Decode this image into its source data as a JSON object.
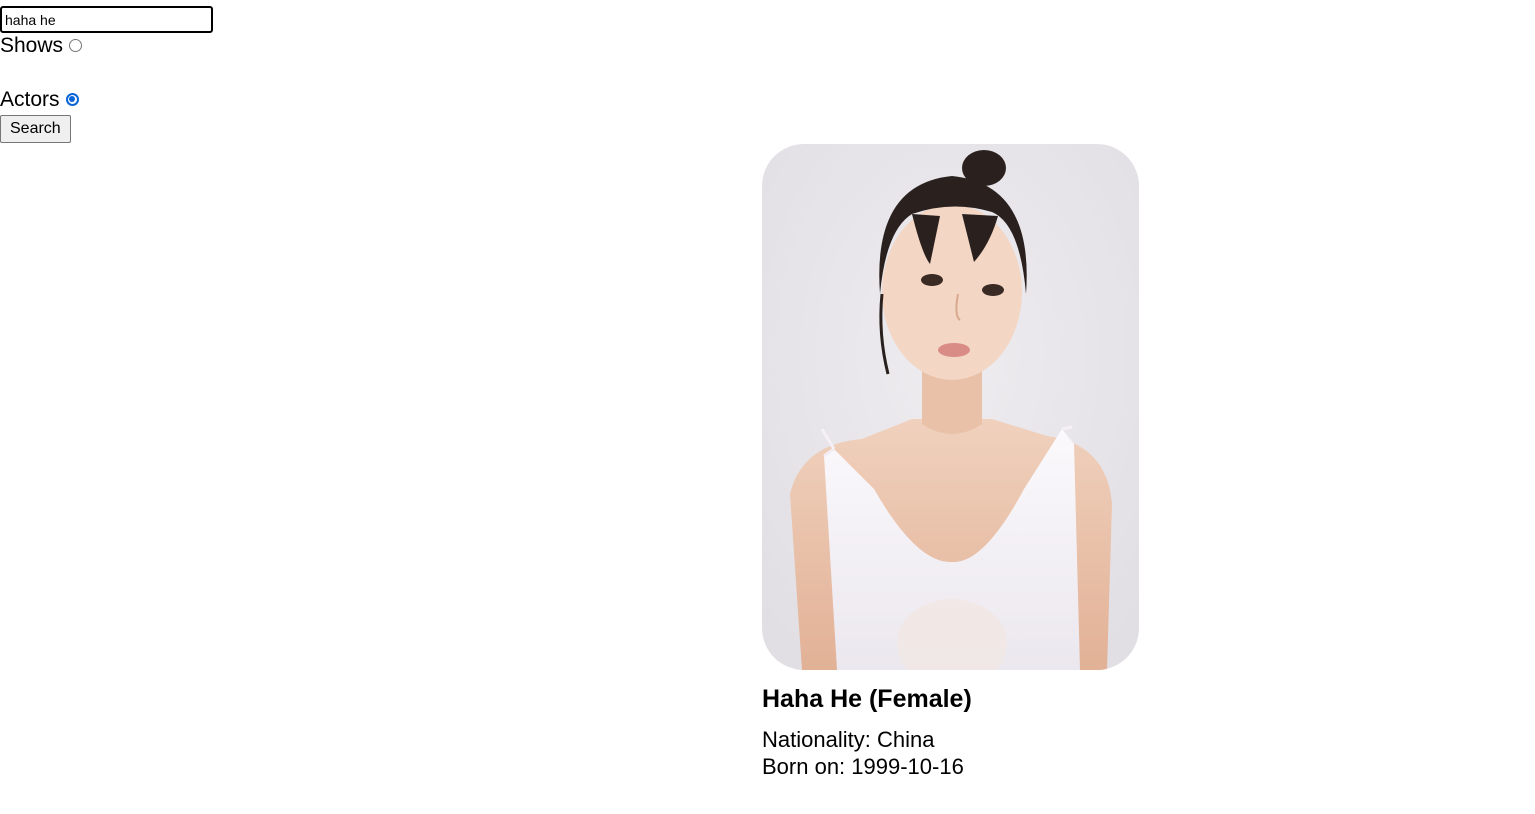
{
  "search": {
    "query": "haha he",
    "options": [
      {
        "label": "Shows",
        "checked": false
      },
      {
        "label": "Actors",
        "checked": true
      }
    ],
    "button_label": "Search"
  },
  "result": {
    "name": "Haha He (Female)",
    "nationality": "Nationality: China",
    "born": "Born on: 1999-10-16",
    "photo_icon": "actor-portrait"
  }
}
